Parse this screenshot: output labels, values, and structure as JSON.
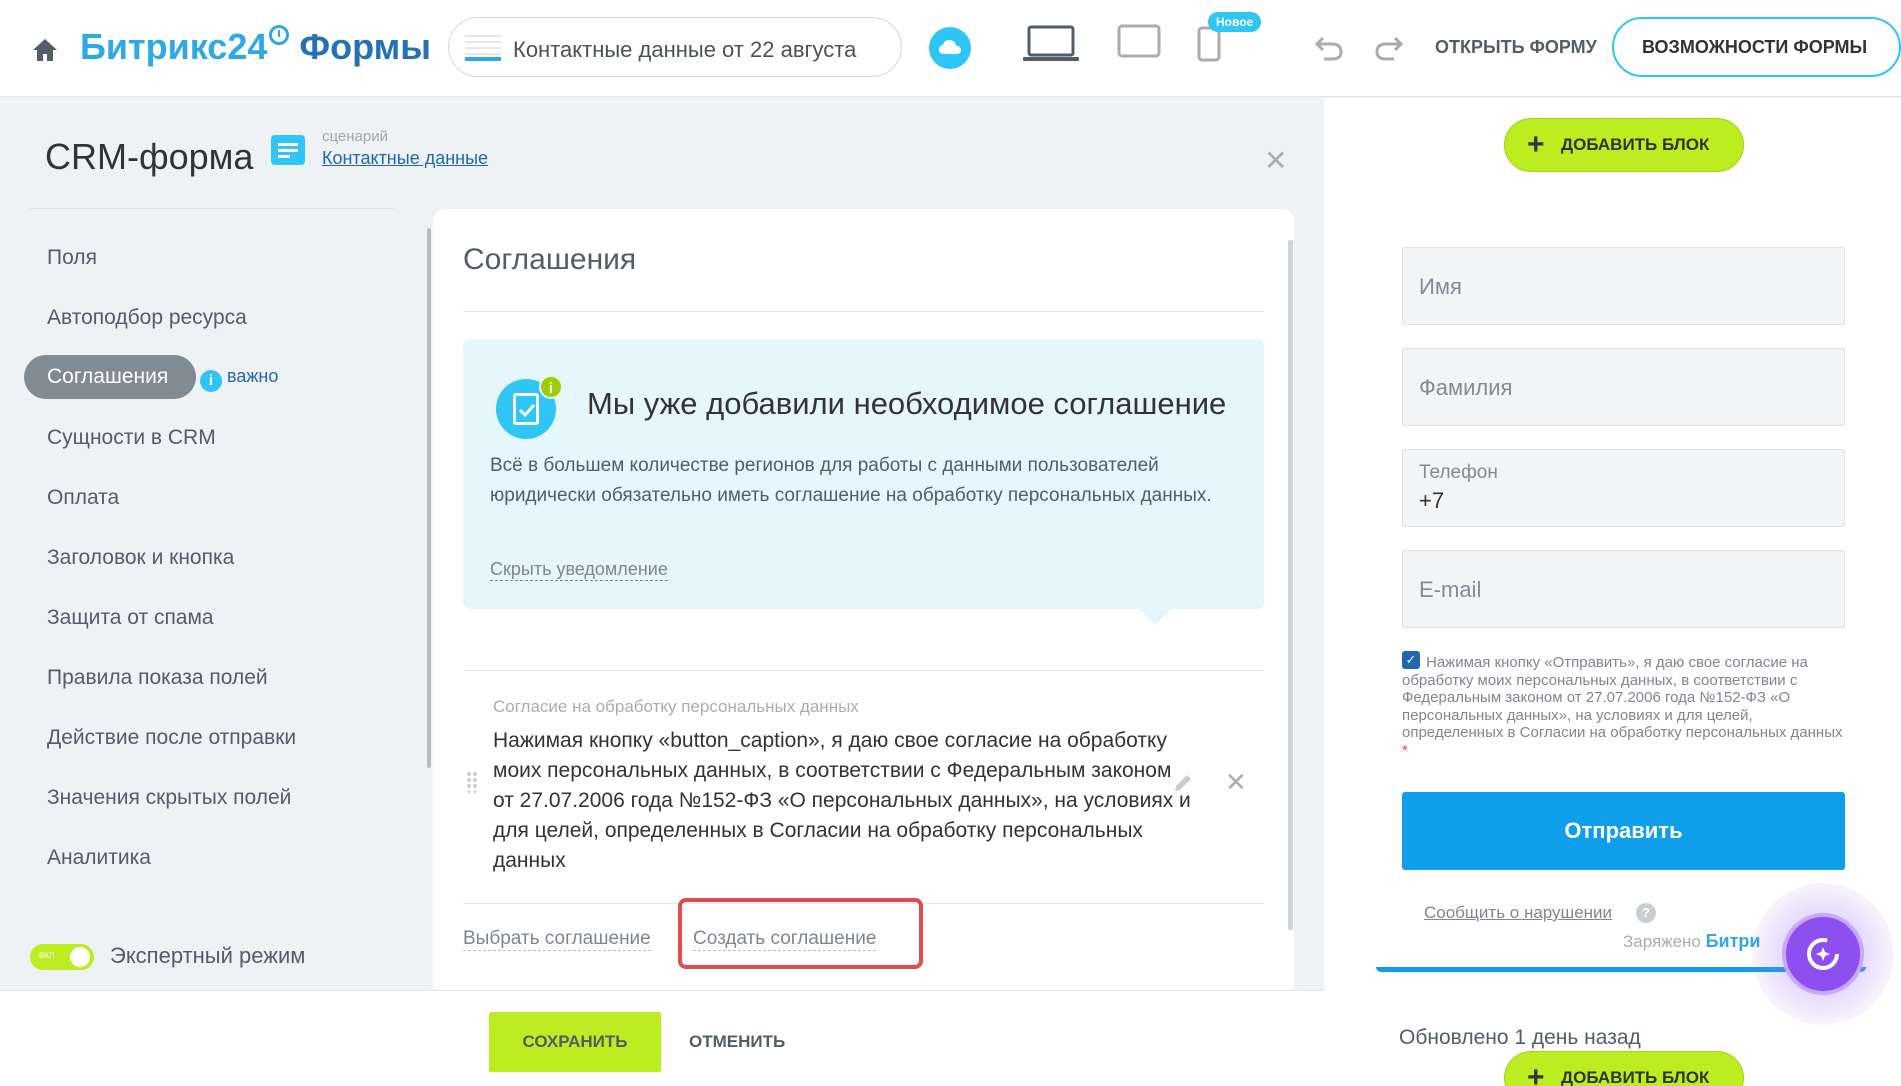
{
  "header": {
    "logo_b24": "Битрикс24",
    "logo_forms": "Формы",
    "form_title": "Контактные данные от 22 августа",
    "new_badge": "Новое",
    "open_form": "ОТКРЫТЬ ФОРМУ",
    "features": "ВОЗМОЖНОСТИ ФОРМЫ"
  },
  "sidebar": {
    "title": "CRM-форма",
    "scenario_label": "сценарий",
    "scenario_link": "Контактные данные",
    "items": [
      {
        "label": "Поля"
      },
      {
        "label": "Автоподбор ресурса"
      },
      {
        "label": "Соглашения"
      },
      {
        "label": "Сущности в CRM"
      },
      {
        "label": "Оплата"
      },
      {
        "label": "Заголовок и кнопка"
      },
      {
        "label": "Защита от спама"
      },
      {
        "label": "Правила показа полей"
      },
      {
        "label": "Действие после отправки"
      },
      {
        "label": "Значения скрытых полей"
      },
      {
        "label": "Аналитика"
      }
    ],
    "important": "важно",
    "toggle_label": "вкл",
    "expert_mode": "Экспертный режим"
  },
  "main": {
    "title": "Соглашения",
    "notice": {
      "title": "Мы уже добавили необходимое соглашение",
      "text": "Всё в большем количестве регионов для работы с данными пользователей юридически обязательно иметь соглашение на обработку персональных данных.",
      "hide": "Скрыть уведомление"
    },
    "consent": {
      "label": "Согласие на обработку персональных данных",
      "text": "Нажимая кнопку «button_caption», я даю свое согласие на обработку моих персональных данных, в соответствии с Федеральным законом от 27.07.2006 года №152-ФЗ «О персональных данных», на условиях и для целей, определенных в Согласии на обработку персональных данных"
    },
    "choose": "Выбрать соглашение",
    "create": "Создать соглашение"
  },
  "footer": {
    "save": "СОХРАНИТЬ",
    "cancel": "ОТМЕНИТЬ"
  },
  "preview": {
    "add_block": "ДОБАВИТЬ БЛОК",
    "fields": {
      "first_name": "Имя",
      "last_name": "Фамилия",
      "phone_label": "Телефон",
      "phone_value": "+7",
      "email": "E-mail"
    },
    "agreement": "Нажимая кнопку «Отправить», я даю свое согласие на обработку моих персональных данных, в соответствии с Федеральным законом от 27.07.2006 года №152-ФЗ «О персональных данных», на условиях и для целей, определенных в Согласии на обработку персональных данных",
    "required_mark": "*",
    "send": "Отправить",
    "report": "Сообщить о нарушении",
    "powered_prefix": "Заряжено",
    "powered_brand": "Битри",
    "updated": "Обновлено 1 день назад"
  },
  "colors": {
    "accent": "#2fc6f6",
    "brand_blue": "#2fa9e6",
    "green": "#bbed21",
    "send_blue": "#0f9eea",
    "highlight_red": "#e04b4f"
  }
}
